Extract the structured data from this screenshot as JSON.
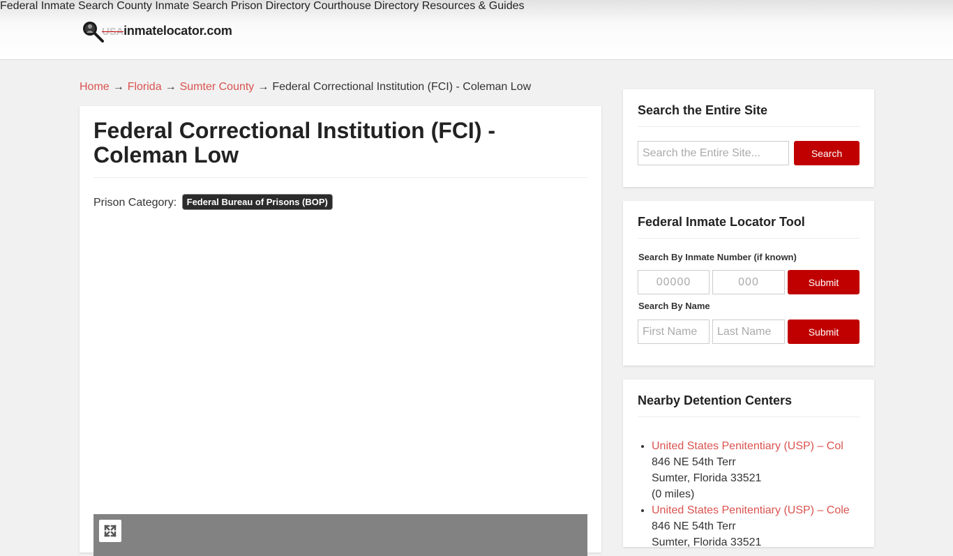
{
  "header": {
    "logo_usa": "USA",
    "logo_rest": "inmatelocator.com",
    "nav": [
      {
        "label": "Federal Inmate Search"
      },
      {
        "label": "County Inmate Search"
      },
      {
        "label": "Prison Directory"
      },
      {
        "label": "Courthouse Directory"
      },
      {
        "label": "Resources & Guides"
      }
    ]
  },
  "breadcrumb": {
    "items": [
      "Home",
      "Florida",
      "Sumter County"
    ],
    "current": "Federal Correctional Institution (FCI) - Coleman Low",
    "separator": "→"
  },
  "main": {
    "title": "Federal Correctional Institution (FCI) - Coleman Low",
    "category_label": "Prison Category:",
    "category_badge": "Federal Bureau of Prisons (BOP)"
  },
  "sidebar": {
    "site_search": {
      "title": "Search the Entire Site",
      "placeholder": "Search the Entire Site...",
      "button": "Search"
    },
    "locator": {
      "title": "Federal Inmate Locator Tool",
      "number_label": "Search By Inmate Number (if known)",
      "number_placeholder_1": "00000",
      "number_placeholder_2": "000",
      "name_label": "Search By Name",
      "first_placeholder": "First Name",
      "last_placeholder": "Last Name",
      "submit": "Submit"
    },
    "nearby": {
      "title": "Nearby Detention Centers",
      "items": [
        {
          "name": "United States Penitentiary (USP) – Col",
          "street": "846 NE 54th Terr",
          "city": "Sumter, Florida 33521",
          "distance": "(0 miles)"
        },
        {
          "name": "United States Penitentiary (USP) – Cole",
          "street": "846 NE 54th Terr",
          "city": "Sumter, Florida 33521",
          "distance": ""
        }
      ]
    }
  },
  "colors": {
    "accent_red": "#c00000",
    "link_red": "#d9534f",
    "badge_bg": "#2b2b2b"
  }
}
